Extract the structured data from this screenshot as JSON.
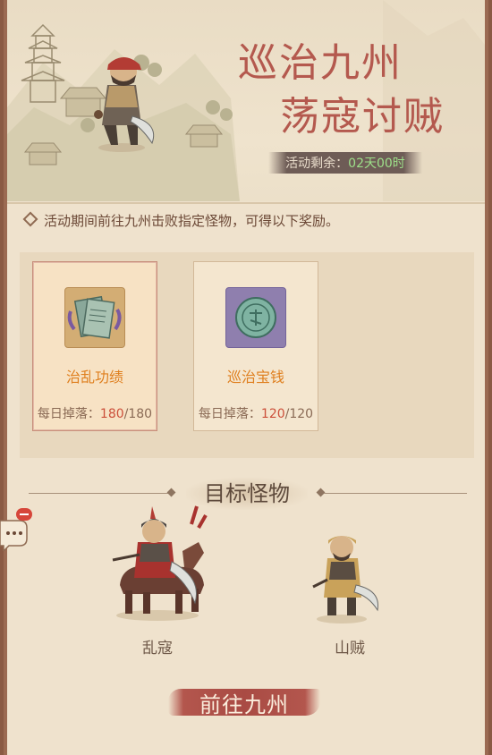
{
  "banner": {
    "title_line1": "巡治九州",
    "title_line2": "荡寇讨贼",
    "timer_label": "活动剩余：",
    "timer_value": "02天00时"
  },
  "description": "活动期间前往九州击败指定怪物，可得以下奖励。",
  "rewards": [
    {
      "name": "治乱功绩",
      "drop_label": "每日掉落：",
      "drop_current": "180",
      "drop_sep_max": "/180",
      "icon": "scroll-documents-icon"
    },
    {
      "name": "巡治宝钱",
      "drop_label": "每日掉落：",
      "drop_current": "120",
      "drop_sep_max": "/120",
      "icon": "jade-coin-icon"
    }
  ],
  "targets": {
    "heading": "目标怪物",
    "monsters": [
      {
        "name": "乱寇",
        "icon": "mounted-bandit-icon"
      },
      {
        "name": "山贼",
        "icon": "mountain-bandit-icon"
      }
    ]
  },
  "go_button": {
    "label": "前往九州"
  },
  "colors": {
    "title_red": "#b4594e",
    "timer_green": "#9ee08a",
    "reward_orange": "#df7f1e",
    "drop_red": "#cc4f3a",
    "button_red": "#a94b44"
  }
}
